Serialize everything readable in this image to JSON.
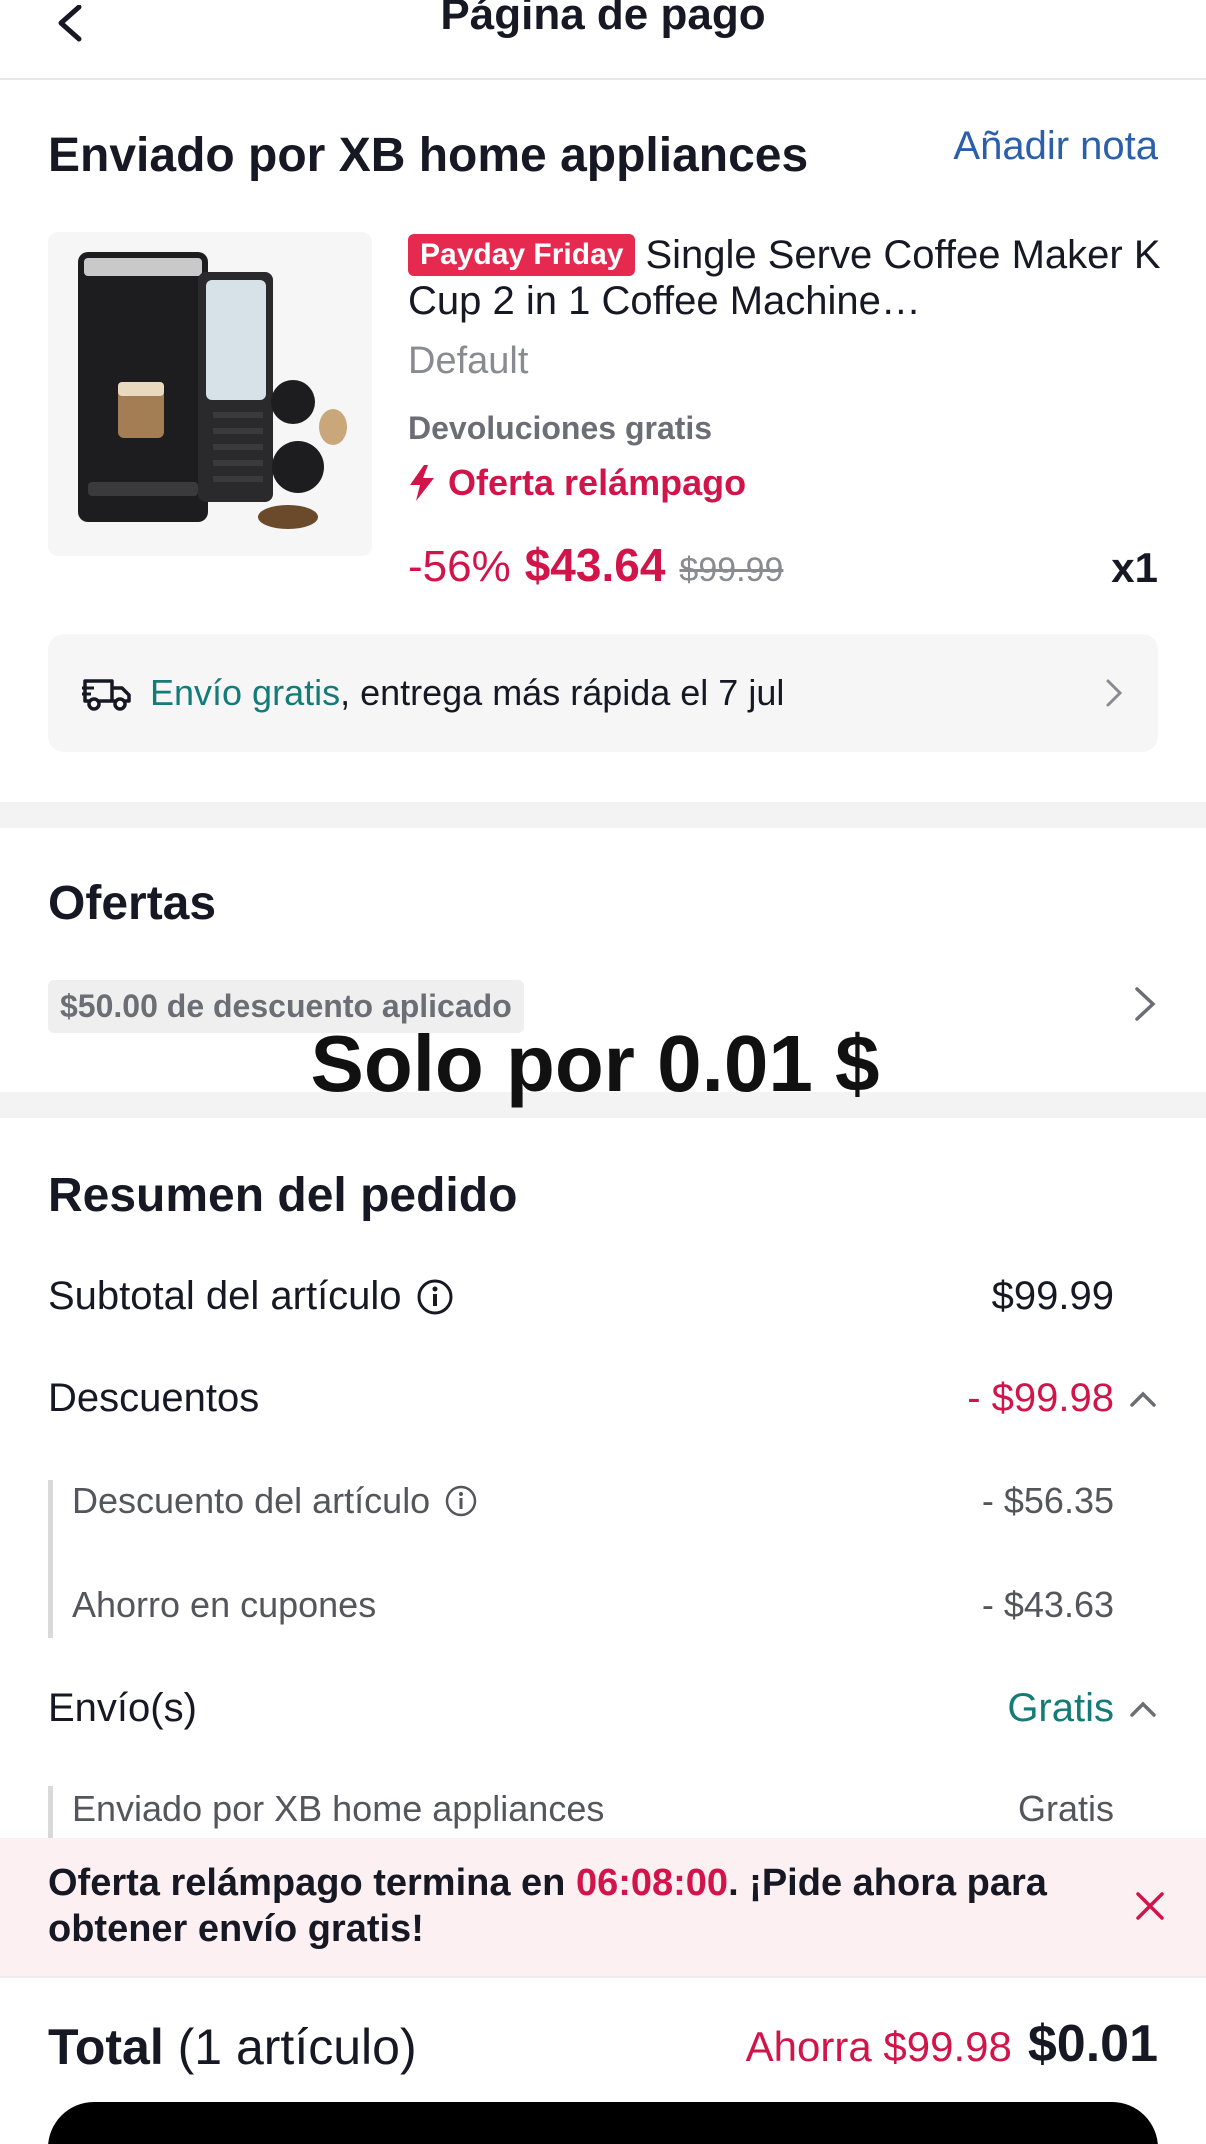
{
  "header": {
    "title": "Página de pago"
  },
  "seller": {
    "title": "Enviado por XB home appliances",
    "add_note": "Añadir nota"
  },
  "product": {
    "badge": "Payday Friday",
    "title": "Single Serve Coffee Maker K Cup 2 in 1 Coffee Machine…",
    "variant": "Default",
    "returns": "Devoluciones gratis",
    "flash": "Oferta relámpago",
    "discount_pct": "-56%",
    "price": "$43.64",
    "original_price": "$99.99",
    "quantity": "x1"
  },
  "shipping": {
    "free": "Envío gratis",
    "eta": ", entrega más rápida el 7 jul"
  },
  "offers": {
    "title": "Ofertas",
    "chip": "$50.00 de descuento aplicado",
    "overlay": "Solo por 0.01 $"
  },
  "summary": {
    "title": "Resumen del pedido",
    "subtotal_label": "Subtotal del artículo",
    "subtotal_value": "$99.99",
    "discounts_label": "Descuentos",
    "discounts_value": "- $99.98",
    "item_discount_label": "Descuento del artículo",
    "item_discount_value": "- $56.35",
    "coupon_label": "Ahorro en cupones",
    "coupon_value": "- $43.63",
    "shipping_label": "Envío(s)",
    "shipping_value": "Gratis",
    "shipped_by_label": "Enviado por XB home appliances",
    "shipped_by_value": "Gratis"
  },
  "banner": {
    "text_a": "Oferta relámpago termina en ",
    "time": "06:08:00",
    "text_b": ". ¡Pide ahora para obtener envío gratis!"
  },
  "footer": {
    "total_label": "Total",
    "items": " (1 artículo)",
    "save": "Ahorra $99.98",
    "total": "$0.01"
  },
  "colors": {
    "accent": "#d1144a",
    "teal": "#137b78",
    "link": "#2c5fab"
  }
}
